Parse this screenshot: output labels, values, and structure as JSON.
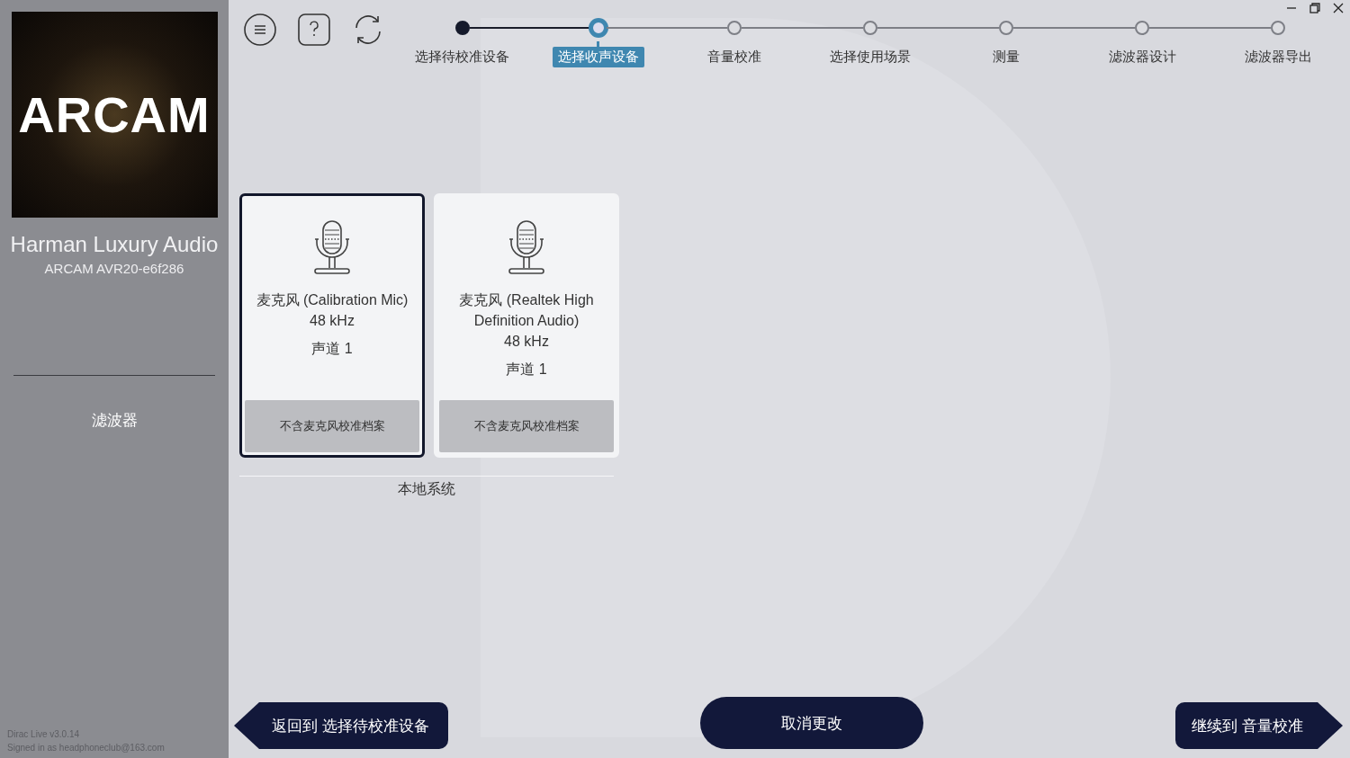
{
  "sidebar": {
    "logo": "ARCAM",
    "brand": "Harman Luxury Audio",
    "device": "ARCAM AVR20-e6f286",
    "nav": [
      {
        "label": "滤波器",
        "selected": false
      }
    ],
    "version": "Dirac Live v3.0.14",
    "signed_in": "Signed in as headphoneclub@163.com"
  },
  "steps": [
    {
      "label": "选择待校准设备",
      "done": true,
      "selected": false
    },
    {
      "label": "选择收声设备",
      "done": false,
      "selected": true
    },
    {
      "label": "音量校准",
      "done": false,
      "selected": false
    },
    {
      "label": "选择使用场景",
      "done": false,
      "selected": false
    },
    {
      "label": "测量",
      "done": false,
      "selected": false
    },
    {
      "label": "滤波器设计",
      "done": false,
      "selected": false
    },
    {
      "label": "滤波器导出",
      "done": false,
      "selected": false
    }
  ],
  "devices": [
    {
      "name": "麦克风 (Calibration Mic)",
      "rate": "48 kHz",
      "channel": "声道 1",
      "profile": "不含麦克风校准档案",
      "selected": true
    },
    {
      "name": "麦克风 (Realtek High Definition Audio)",
      "rate": "48 kHz",
      "channel": "声道 1",
      "profile": "不含麦克风校准档案",
      "selected": false
    }
  ],
  "group_label": "本地系统",
  "buttons": {
    "back": "返回到 选择待校准设备",
    "cancel": "取消更改",
    "next": "继续到 音量校准"
  }
}
